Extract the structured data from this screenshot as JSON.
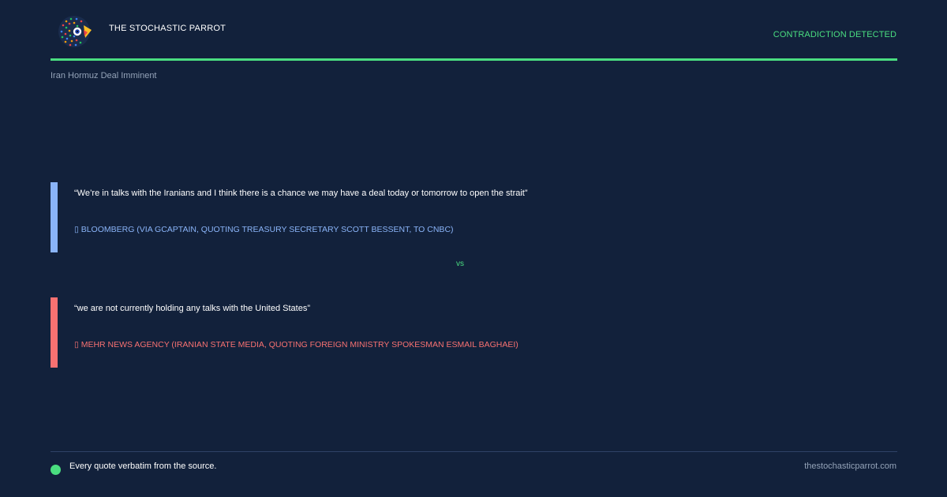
{
  "header": {
    "brand": "THE STOCHASTIC PARROT",
    "status": "CONTRADICTION DETECTED",
    "logo_icon": "parrot-logo-icon"
  },
  "topic": "Iran Hormuz Deal Imminent",
  "quotes": [
    {
      "text": "“We’re in talks with the Iranians and I think there is a chance we may have a deal today or tomorrow to open the strait”",
      "source": "▯ BLOOMBERG (VIA GCAPTAIN, QUOTING TREASURY SECRETARY SCOTT BESSENT, TO CNBC)",
      "accent": "#8ab4f8"
    },
    {
      "text": "“we are not currently holding any talks with the United States”",
      "source": "▯ MEHR NEWS AGENCY (IRANIAN STATE MEDIA, QUOTING FOREIGN MINISTRY SPOKESMAN ESMAIL BAGHAEI)",
      "accent": "#f87171"
    }
  ],
  "separator": "vs",
  "footer": {
    "note": "Every quote verbatim from the source.",
    "site": "thestochasticparrot.com"
  },
  "colors": {
    "background": "#12213b",
    "accent_green": "#4ade80",
    "muted": "#94a3b8"
  }
}
